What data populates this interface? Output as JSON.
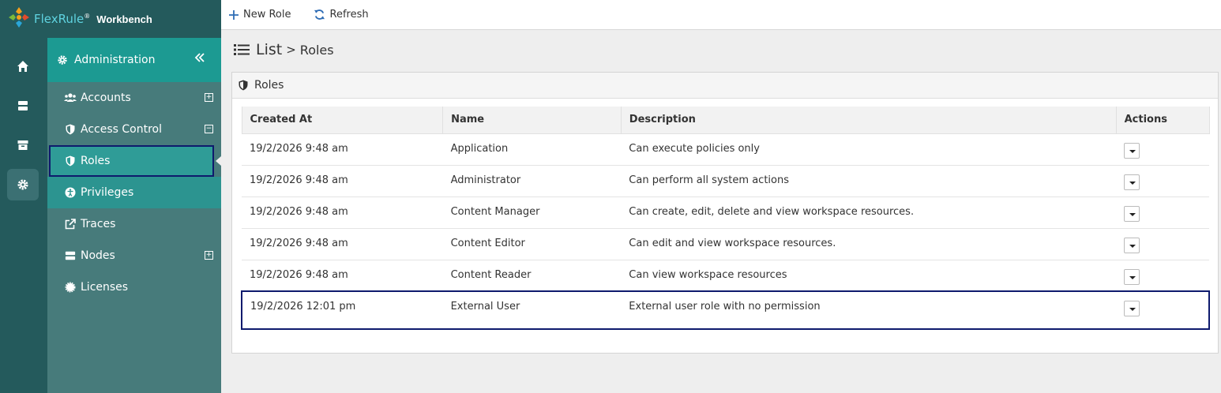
{
  "brand": {
    "name": "FlexRule",
    "reg": "®",
    "sub": "Workbench"
  },
  "rail": [
    {
      "icon": "home-icon"
    },
    {
      "icon": "server-icon"
    },
    {
      "icon": "archive-icon"
    },
    {
      "icon": "gear-icon",
      "active": true
    }
  ],
  "nav": {
    "header": "Administration",
    "items": [
      {
        "label": "Accounts",
        "icon": "users-icon",
        "expandable": true
      },
      {
        "label": "Access Control",
        "icon": "shield-icon",
        "expandable": true,
        "expanded": true
      },
      {
        "label": "Roles",
        "icon": "shield-icon",
        "selected": true
      },
      {
        "label": "Privileges",
        "icon": "accessibility-icon"
      },
      {
        "label": "Traces",
        "icon": "external-link-icon"
      },
      {
        "label": "Nodes",
        "icon": "server-icon",
        "expandable": true
      },
      {
        "label": "Licenses",
        "icon": "certificate-icon"
      }
    ]
  },
  "toolbar": {
    "new_role": "New Role",
    "refresh": "Refresh"
  },
  "page": {
    "title": "List",
    "separator": ">",
    "crumb": "Roles"
  },
  "panel": {
    "title": "Roles"
  },
  "table": {
    "columns": [
      "Created At",
      "Name",
      "Description",
      "Actions"
    ],
    "rows": [
      {
        "created": "19/2/2026 9:48 am",
        "name": "Application",
        "description": "Can execute policies only"
      },
      {
        "created": "19/2/2026 9:48 am",
        "name": "Administrator",
        "description": "Can perform all system actions"
      },
      {
        "created": "19/2/2026 9:48 am",
        "name": "Content Manager",
        "description": "Can create, edit, delete and view workspace resources."
      },
      {
        "created": "19/2/2026 9:48 am",
        "name": "Content Editor",
        "description": "Can edit and view workspace resources."
      },
      {
        "created": "19/2/2026 9:48 am",
        "name": "Content Reader",
        "description": "Can view workspace resources"
      },
      {
        "created": "19/2/2026 12:01 pm",
        "name": "External User",
        "description": "External user role with no permission"
      }
    ]
  },
  "colors": {
    "rail": "#245a5c",
    "nav": "#477b7b",
    "nav_header": "#1c9a92",
    "selected_outline": "#0e1a6d"
  }
}
